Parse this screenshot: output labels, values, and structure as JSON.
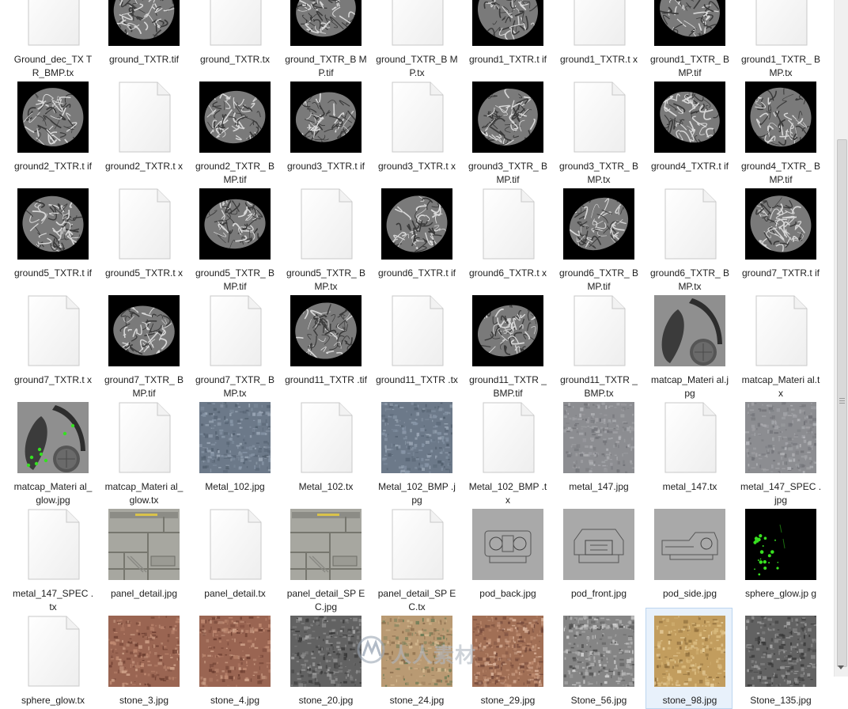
{
  "files": [
    {
      "name": "Ground_dec_TX TR_BMP.tx",
      "thumb": "blank"
    },
    {
      "name": "ground_TXTR.tif",
      "thumb": "ground"
    },
    {
      "name": "ground_TXTR.tx",
      "thumb": "blank"
    },
    {
      "name": "ground_TXTR_B MP.tif",
      "thumb": "ground"
    },
    {
      "name": "ground_TXTR_B MP.tx",
      "thumb": "blank"
    },
    {
      "name": "ground1_TXTR.t if",
      "thumb": "ground"
    },
    {
      "name": "ground1_TXTR.t x",
      "thumb": "blank"
    },
    {
      "name": "ground1_TXTR_ BMP.tif",
      "thumb": "ground"
    },
    {
      "name": "ground1_TXTR_ BMP.tx",
      "thumb": "blank"
    },
    {
      "name": "ground2_TXTR.t if",
      "thumb": "ground"
    },
    {
      "name": "ground2_TXTR.t x",
      "thumb": "blank"
    },
    {
      "name": "ground2_TXTR_ BMP.tif",
      "thumb": "ground"
    },
    {
      "name": "ground3_TXTR.t if",
      "thumb": "ground"
    },
    {
      "name": "ground3_TXTR.t x",
      "thumb": "blank"
    },
    {
      "name": "ground3_TXTR_ BMP.tif",
      "thumb": "ground"
    },
    {
      "name": "ground3_TXTR_ BMP.tx",
      "thumb": "blank"
    },
    {
      "name": "ground4_TXTR.t if",
      "thumb": "ground"
    },
    {
      "name": "ground4_TXTR_ BMP.tif",
      "thumb": "ground"
    },
    {
      "name": "ground5_TXTR.t if",
      "thumb": "ground"
    },
    {
      "name": "ground5_TXTR.t x",
      "thumb": "blank"
    },
    {
      "name": "ground5_TXTR_ BMP.tif",
      "thumb": "ground"
    },
    {
      "name": "ground5_TXTR_ BMP.tx",
      "thumb": "blank"
    },
    {
      "name": "ground6_TXTR.t if",
      "thumb": "ground"
    },
    {
      "name": "ground6_TXTR.t x",
      "thumb": "blank"
    },
    {
      "name": "ground6_TXTR_ BMP.tif",
      "thumb": "ground"
    },
    {
      "name": "ground6_TXTR_ BMP.tx",
      "thumb": "blank"
    },
    {
      "name": "ground7_TXTR.t if",
      "thumb": "ground"
    },
    {
      "name": "ground7_TXTR.t x",
      "thumb": "blank"
    },
    {
      "name": "ground7_TXTR_ BMP.tif",
      "thumb": "ground"
    },
    {
      "name": "ground7_TXTR_ BMP.tx",
      "thumb": "blank"
    },
    {
      "name": "ground11_TXTR .tif",
      "thumb": "ground"
    },
    {
      "name": "ground11_TXTR .tx",
      "thumb": "blank"
    },
    {
      "name": "ground11_TXTR _BMP.tif",
      "thumb": "ground"
    },
    {
      "name": "ground11_TXTR _BMP.tx",
      "thumb": "blank"
    },
    {
      "name": "matcap_Materi al.jpg",
      "thumb": "matcap"
    },
    {
      "name": "matcap_Materi al.tx",
      "thumb": "blank"
    },
    {
      "name": "matcap_Materi al_glow.jpg",
      "thumb": "matcap-glow"
    },
    {
      "name": "matcap_Materi al_glow.tx",
      "thumb": "blank"
    },
    {
      "name": "Metal_102.jpg",
      "thumb": "metal-blue"
    },
    {
      "name": "Metal_102.tx",
      "thumb": "blank"
    },
    {
      "name": "Metal_102_BMP .jpg",
      "thumb": "metal-blue"
    },
    {
      "name": "Metal_102_BMP .tx",
      "thumb": "blank"
    },
    {
      "name": "metal_147.jpg",
      "thumb": "metal-grey"
    },
    {
      "name": "metal_147.tx",
      "thumb": "blank"
    },
    {
      "name": "metal_147_SPEC .jpg",
      "thumb": "metal-grey"
    },
    {
      "name": "metal_147_SPEC .tx",
      "thumb": "blank"
    },
    {
      "name": "panel_detail.jpg",
      "thumb": "panel"
    },
    {
      "name": "panel_detail.tx",
      "thumb": "blank"
    },
    {
      "name": "panel_detail_SP EC.jpg",
      "thumb": "panel"
    },
    {
      "name": "panel_detail_SP EC.tx",
      "thumb": "blank"
    },
    {
      "name": "pod_back.jpg",
      "thumb": "pod-back"
    },
    {
      "name": "pod_front.jpg",
      "thumb": "pod-front"
    },
    {
      "name": "pod_side.jpg",
      "thumb": "pod-side"
    },
    {
      "name": "sphere_glow.jp g",
      "thumb": "sphere-glow"
    },
    {
      "name": "sphere_glow.tx",
      "thumb": "blank"
    },
    {
      "name": "stone_3.jpg",
      "thumb": "stone-red"
    },
    {
      "name": "stone_4.jpg",
      "thumb": "stone-red"
    },
    {
      "name": "stone_20.jpg",
      "thumb": "stone-grey"
    },
    {
      "name": "stone_24.jpg",
      "thumb": "stone-sand"
    },
    {
      "name": "stone_29.jpg",
      "thumb": "stone-gravel"
    },
    {
      "name": "Stone_56.jpg",
      "thumb": "stone-rubble"
    },
    {
      "name": "stone_98.jpg",
      "thumb": "stone-yellow",
      "selected": true
    },
    {
      "name": "Stone_135.jpg",
      "thumb": "stone-grey"
    }
  ],
  "watermark_text": "人人素材",
  "colors": {
    "selection_bg": "#e8f1fb",
    "selection_border": "#bcd6f0",
    "scrollbar": "#f0f0f0"
  }
}
